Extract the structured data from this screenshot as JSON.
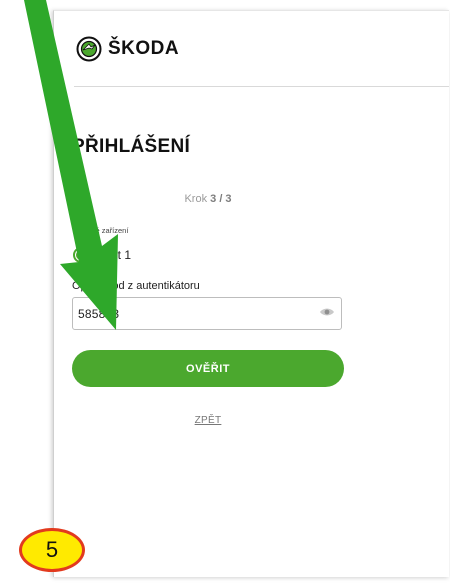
{
  "brand": {
    "name": "ŠKODA",
    "accent_color": "#4ba82e",
    "logo_icon": "skoda-arrow-logo"
  },
  "login": {
    "title": "PŘIHLÁŠENÍ",
    "step_prefix": "Krok",
    "step_value": "3 / 3",
    "device_label": "Vybrané zařízení",
    "device_name": "Test 1",
    "code_label": "Opište kód z autentikátoru",
    "code_value": "585883",
    "eye_icon": "eye-icon",
    "verify_button": "OVĚŘIT",
    "back_link": "ZPĚT"
  },
  "annotation": {
    "step_number": "5",
    "arrow_color": "#2ea82a",
    "badge_color": "#ffea00",
    "badge_border": "#e23a1e"
  }
}
